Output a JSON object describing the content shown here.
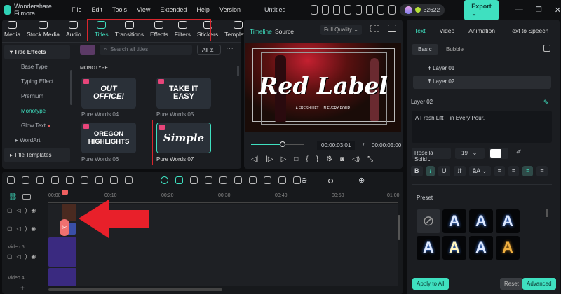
{
  "app": {
    "name": "Wondershare Filmora",
    "project": "Untitled",
    "credits": "32622",
    "export": "Export"
  },
  "menu": [
    "File",
    "Edit",
    "Tools",
    "View",
    "Extended",
    "Help",
    "Version"
  ],
  "toolbar": [
    "Media",
    "Stock Media",
    "Audio",
    "Titles",
    "Transitions",
    "Effects",
    "Filters",
    "Stickers",
    "Templates"
  ],
  "sidebar": {
    "header": "Title Effects",
    "items": [
      "Base Type",
      "Typing Effect",
      "Premium",
      "Monotype",
      "Glow Text",
      "WordArt"
    ],
    "footer": "Title Templates"
  },
  "browser": {
    "search_placeholder": "Search all titles",
    "filter": "All",
    "section": "MONOTYPE",
    "cards": [
      {
        "name": "Pure Words 04",
        "preview": "OUT OFFICE!"
      },
      {
        "name": "Pure Words 05",
        "preview": "TAKE IT EASY"
      },
      {
        "name": "Pure Words 06",
        "preview": "OREGON HIGHLIGHTS"
      },
      {
        "name": "Pure Words 07",
        "preview": "Simple"
      }
    ]
  },
  "preview": {
    "tabs": [
      "Timeline",
      "Source"
    ],
    "quality": "Full Quality",
    "title": "Red Label",
    "subtitle": "A FRESH LIFT    IN EVERY POUR.",
    "current": "00:00:03:01",
    "sep": "/",
    "total": "00:00:05:00",
    "progress": 0.6
  },
  "props": {
    "tabs": [
      "Text",
      "Video",
      "Animation",
      "Text to Speech"
    ],
    "subtabs": [
      "Basic",
      "Bubble"
    ],
    "layers": [
      "Layer 01",
      "Layer 02"
    ],
    "selected_layer": "Layer 02",
    "text": "A Fresh Lift    in Every Pour.",
    "font": "Rosella Solid",
    "size": "19",
    "preset_label": "Preset",
    "apply_all": "Apply to All",
    "reset": "Reset",
    "advanced": "Advanced"
  },
  "timeline": {
    "ticks": [
      "00:00",
      "00:10",
      "00:20",
      "00:30",
      "00:40",
      "00:50",
      "01:00"
    ],
    "tracks": [
      "Video 5",
      "Video 4"
    ]
  }
}
